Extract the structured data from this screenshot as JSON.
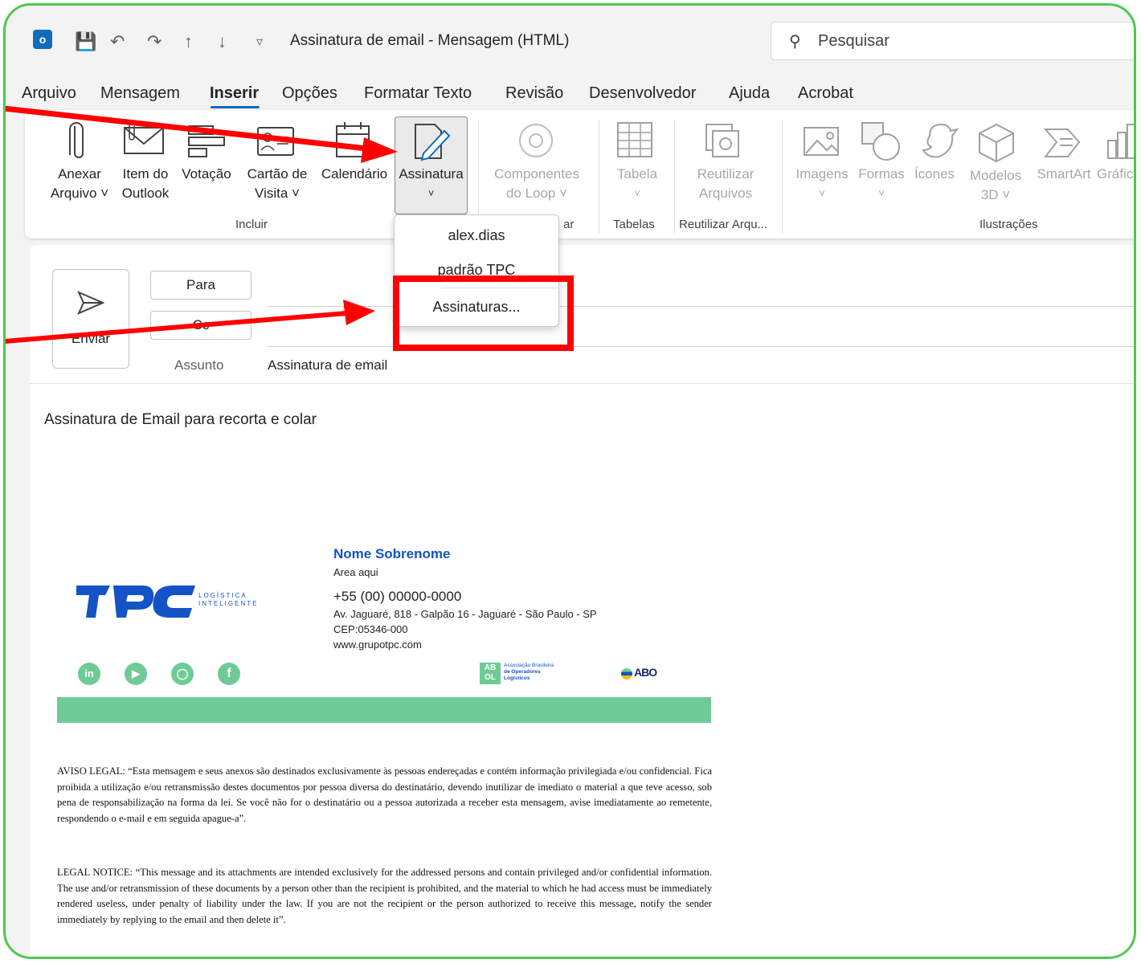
{
  "window": {
    "title": "Assinatura de email  -  Mensagem (HTML)",
    "search_placeholder": "Pesquisar"
  },
  "menu": {
    "tabs": [
      "Arquivo",
      "Mensagem",
      "Inserir",
      "Opções",
      "Formatar Texto",
      "Revisão",
      "Desenvolvedor",
      "Ajuda",
      "Acrobat"
    ],
    "active": "Inserir"
  },
  "ribbon": {
    "anexar": [
      "Anexar",
      "Arquivo ˅"
    ],
    "item": [
      "Item do",
      "Outlook"
    ],
    "votacao": [
      "Votação",
      ""
    ],
    "cartao": [
      "Cartão de",
      "Visita ˅"
    ],
    "calendario": [
      "Calendário",
      ""
    ],
    "assinatura": [
      "Assinatura",
      "˅"
    ],
    "componentes": [
      "Componentes",
      "do Loop ˅"
    ],
    "tabela": [
      "Tabela",
      "˅"
    ],
    "reutilizar": [
      "Reutilizar",
      "Arquivos"
    ],
    "imagens": [
      "Imagens",
      "˅"
    ],
    "formas": [
      "Formas",
      "˅"
    ],
    "icones": [
      "Ícones",
      ""
    ],
    "modelos": [
      "Modelos",
      "3D ˅"
    ],
    "smartart": "SmartArt",
    "grafico": "Gráfic",
    "groups": {
      "incluir": "Incluir",
      "loop_partial": "ar",
      "tabelas": "Tabelas",
      "reutilizar": "Reutilizar Arqu...",
      "ilustracoes": "Ilustrações"
    }
  },
  "dropdown": {
    "items": [
      "alex.dias",
      "padrão TPC",
      "Assinaturas..."
    ]
  },
  "compose": {
    "send": "Enviar",
    "to": "Para",
    "cc": "Cc",
    "subject_label": "Assunto",
    "subject_value": "Assinatura de email"
  },
  "body": {
    "intro": "Assinatura de Email para recorta e colar",
    "signature": {
      "name": "Nome Sobrenome",
      "area": "Area aqui",
      "phone": "+55 (00) 00000-0000",
      "address": "Av. Jaguaré, 818 - Galpão 16 - Jaguaré - São Paulo - SP",
      "cep": "CEP:05346-000",
      "site": "www.grupotpc.com",
      "logo_text": "TPC",
      "logo_tag1": "LOGÍSTICA",
      "logo_tag2": "INTELIGENTE",
      "abol_line1": "Associação Brasileira",
      "abol_line2": "de Operadores",
      "abol_line3": "Logísticos",
      "abo": "ABO"
    },
    "legal_pt": "AVISO LEGAL: “Esta mensagem e seus anexos são destinados exclusivamente às pessoas endereçadas e contém informação privilegiada e/ou confidencial. Fica proibida a utilização e/ou retransmissão destes documentos por pessoa diversa do destinatário, devendo inutilizar de imediato o material a que teve acesso, sob pena de responsabilização na forma da lei. Se você não for o destinatário ou a pessoa autorizada a receber esta mensagem, avise imediatamente ao remetente, respondendo o e-mail e em seguida apague-a”.",
    "legal_en": "LEGAL NOTICE: “This message and its attachments are intended exclusively for the addressed persons and contain privileged and/or confidential information. The use and/or retransmission of these documents by a person other than the recipient is prohibited, and the material to which he had access must be immediately rendered useless, under penalty of liability under the law. If you are not the recipient or the person authorized to receive this message, notify the sender immediately by replying to the email and then delete it”."
  },
  "colors": {
    "accent": "#0f6cbd",
    "highlight": "#ff0000",
    "frame": "#4cc94c",
    "brand_blue": "#1453c4",
    "brand_green": "#6fcb96"
  }
}
